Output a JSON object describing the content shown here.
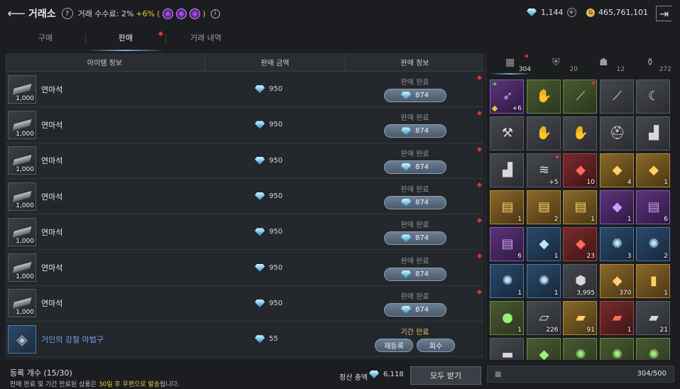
{
  "header": {
    "title": "거래소",
    "fee_label": "거래 수수료: 2%",
    "fee_bonus": "+6%",
    "fee_paren_open": "(",
    "fee_paren_close": ")",
    "gem_amount": "1,144",
    "gold_amount": "465,761,101",
    "gold_symbol": "G"
  },
  "tabs": [
    {
      "label": "구매"
    },
    {
      "label": "판매"
    },
    {
      "label": "거래 내역"
    }
  ],
  "table": {
    "headers": [
      "아이템 정보",
      "판매 금액",
      "판매 정보"
    ],
    "rows": [
      {
        "name": "연마석",
        "qty": "1,000",
        "price": "950",
        "status": "판매 완료",
        "received": "874"
      },
      {
        "name": "연마석",
        "qty": "1,000",
        "price": "950",
        "status": "판매 완료",
        "received": "874"
      },
      {
        "name": "연마석",
        "qty": "1,000",
        "price": "950",
        "status": "판매 완료",
        "received": "874"
      },
      {
        "name": "연마석",
        "qty": "1,000",
        "price": "950",
        "status": "판매 완료",
        "received": "874"
      },
      {
        "name": "연마석",
        "qty": "1,000",
        "price": "950",
        "status": "판매 완료",
        "received": "874"
      },
      {
        "name": "연마석",
        "qty": "1,000",
        "price": "950",
        "status": "판매 완료",
        "received": "874"
      },
      {
        "name": "연마석",
        "qty": "1,000",
        "price": "950",
        "status": "판매 완료",
        "received": "874"
      },
      {
        "name": "거인의 강철 마법구",
        "qty": "",
        "price": "55",
        "status": "기간 만료",
        "relist": "재등록",
        "retrieve": "회수"
      }
    ]
  },
  "footer": {
    "reg_count": "등록 개수 (15/30)",
    "notice_pre": "판매 완료 및 기간 만료된 상품은 ",
    "notice_hl": "30일 후 우편으로 발송",
    "notice_post": "됩니다.",
    "settle_label": "정산 총액",
    "settle_amount": "6,118",
    "receive_all": "모두 받기"
  },
  "inventory": {
    "tabs": [
      {
        "icon": "grid-icon",
        "count": "304"
      },
      {
        "icon": "armor-icon",
        "count": "20"
      },
      {
        "icon": "wolf-icon",
        "count": "12"
      },
      {
        "icon": "potion-icon",
        "count": "272"
      }
    ],
    "slots": [
      {
        "icon": "crossbow-icon",
        "count": "+6",
        "tone": "purple"
      },
      {
        "icon": "gauntlet-icon",
        "count": "",
        "tone": "green"
      },
      {
        "icon": "spear-icon",
        "count": "",
        "tone": "green"
      },
      {
        "icon": "dagger-icon",
        "count": "",
        "tone": "gray"
      },
      {
        "icon": "blade-icon",
        "count": "",
        "tone": "gray"
      },
      {
        "icon": "axe-icon",
        "count": "",
        "tone": "gray"
      },
      {
        "icon": "glove-icon",
        "count": "",
        "tone": "gray"
      },
      {
        "icon": "glove-icon",
        "count": "",
        "tone": "gray"
      },
      {
        "icon": "helmet-icon",
        "count": "",
        "tone": "gray"
      },
      {
        "icon": "boot-icon",
        "count": "",
        "tone": "gray"
      },
      {
        "icon": "boot-icon",
        "count": "",
        "tone": "gray"
      },
      {
        "icon": "cloak-icon",
        "count": "+5",
        "tone": "gray"
      },
      {
        "icon": "red-crystal-icon",
        "count": "10",
        "tone": "red"
      },
      {
        "icon": "orange-crystal-icon",
        "count": "4",
        "tone": "gold"
      },
      {
        "icon": "mixed-crystal-icon",
        "count": "1",
        "tone": "gold"
      },
      {
        "icon": "scroll-icon",
        "count": "1",
        "tone": "gold"
      },
      {
        "icon": "scroll-icon",
        "count": "2",
        "tone": "gold"
      },
      {
        "icon": "scroll-icon",
        "count": "1",
        "tone": "gold"
      },
      {
        "icon": "purple-crystal-icon",
        "count": "1",
        "tone": "purple"
      },
      {
        "icon": "scroll-icon",
        "count": "6",
        "tone": "purple"
      },
      {
        "icon": "scroll-icon",
        "count": "6",
        "tone": "purple"
      },
      {
        "icon": "blue-ore-icon",
        "count": "1",
        "tone": "blue"
      },
      {
        "icon": "ruby-icon",
        "count": "23",
        "tone": "red"
      },
      {
        "icon": "rune-icon",
        "count": "3",
        "tone": "blue"
      },
      {
        "icon": "rune-icon",
        "count": "2",
        "tone": "blue"
      },
      {
        "icon": "rune-icon",
        "count": "1",
        "tone": "blue"
      },
      {
        "icon": "rune-icon",
        "count": "1",
        "tone": "blue"
      },
      {
        "icon": "ore-icon",
        "count": "3,995",
        "tone": "gray"
      },
      {
        "icon": "topaz-icon",
        "count": "370",
        "tone": "gold"
      },
      {
        "icon": "gold-bar-icon",
        "count": "1",
        "tone": "gold"
      },
      {
        "icon": "green-orb-icon",
        "count": "1",
        "tone": "green"
      },
      {
        "icon": "paper-icon",
        "count": "226",
        "tone": "gray"
      },
      {
        "icon": "cloth-icon",
        "count": "91",
        "tone": "gold"
      },
      {
        "icon": "leather-icon",
        "count": "1",
        "tone": "red"
      },
      {
        "icon": "hide-icon",
        "count": "21",
        "tone": "gray"
      },
      {
        "icon": "metal-icon",
        "count": "",
        "tone": "gray"
      },
      {
        "icon": "gem-icon",
        "count": "",
        "tone": "green"
      },
      {
        "icon": "rune-icon",
        "count": "",
        "tone": "green"
      },
      {
        "icon": "rune-icon",
        "count": "",
        "tone": "green"
      },
      {
        "icon": "rune-icon",
        "count": "",
        "tone": "green"
      }
    ],
    "capacity": "304/500"
  }
}
